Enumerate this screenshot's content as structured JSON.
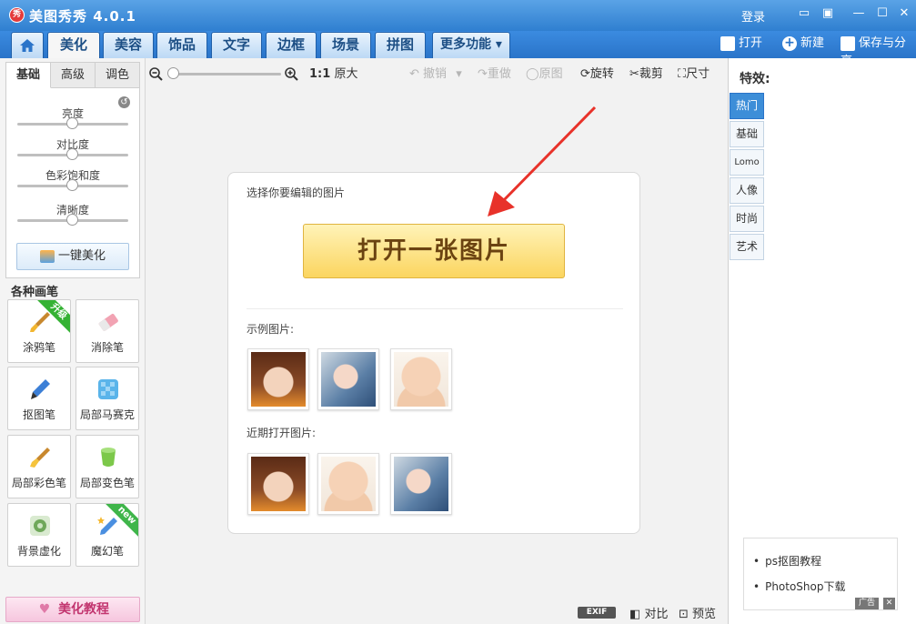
{
  "app": {
    "logo_char": "秀",
    "title": "美图秀秀 4.0.1",
    "login": "登录"
  },
  "window_controls": {
    "msg": "▭",
    "menu": "▣",
    "minimize": "—",
    "maximize": "☐",
    "close": "✕"
  },
  "tabs": [
    {
      "label": "",
      "icon": "home-icon"
    },
    {
      "label": "美化"
    },
    {
      "label": "美容"
    },
    {
      "label": "饰品"
    },
    {
      "label": "文字"
    },
    {
      "label": "边框"
    },
    {
      "label": "场景"
    },
    {
      "label": "拼图"
    },
    {
      "label": "更多功能 ▾"
    }
  ],
  "top_actions": {
    "open": "打开",
    "new": "新建",
    "save": "保存与分享"
  },
  "left": {
    "subtabs": [
      "基础",
      "高级",
      "调色"
    ],
    "sliders": [
      {
        "label": "亮度",
        "value": 0.5
      },
      {
        "label": "对比度",
        "value": 0.5
      },
      {
        "label": "色彩饱和度",
        "value": 0.5
      },
      {
        "label": "清晰度",
        "value": 0.5
      }
    ],
    "auto_beautify": "一键美化",
    "pens_title": "各种画笔",
    "pens": [
      {
        "label": "涂鸦笔",
        "icon": "paintbrush-icon",
        "badge": "升级"
      },
      {
        "label": "消除笔",
        "icon": "eraser-icon",
        "badge": ""
      },
      {
        "label": "抠图笔",
        "icon": "cutout-pen-icon",
        "badge": ""
      },
      {
        "label": "局部马赛克",
        "icon": "mosaic-icon",
        "badge": ""
      },
      {
        "label": "局部彩色笔",
        "icon": "color-brush-icon",
        "badge": ""
      },
      {
        "label": "局部变色笔",
        "icon": "color-change-icon",
        "badge": ""
      },
      {
        "label": "背景虚化",
        "icon": "blur-icon",
        "badge": ""
      },
      {
        "label": "魔幻笔",
        "icon": "magic-pen-icon",
        "badge": "new"
      }
    ],
    "tutorial": "美化教程"
  },
  "toolbar": {
    "zoom_1to1": "1:1",
    "original_size": "原大",
    "undo": "撤销",
    "redo": "重做",
    "original": "原图",
    "rotate": "旋转",
    "crop": "裁剪",
    "resize": "尺寸"
  },
  "card": {
    "prompt": "选择你要编辑的图片",
    "open_button": "打开一张图片",
    "examples_label": "示例图片:",
    "recent_label": "近期打开图片:"
  },
  "bottom": {
    "exif": "EXIF",
    "compare": "对比",
    "preview": "预览"
  },
  "right": {
    "fx_title": "特效:",
    "fx_tabs": [
      "热门",
      "基础",
      "Lomo",
      "人像",
      "时尚",
      "艺术"
    ],
    "ad_links": [
      "ps抠图教程",
      "PhotoShop下载"
    ],
    "ad_tag": "广告"
  },
  "colors": {
    "accent": "#2f7fd0",
    "open_button": "#fbd55f",
    "arrow": "#e8322a"
  }
}
